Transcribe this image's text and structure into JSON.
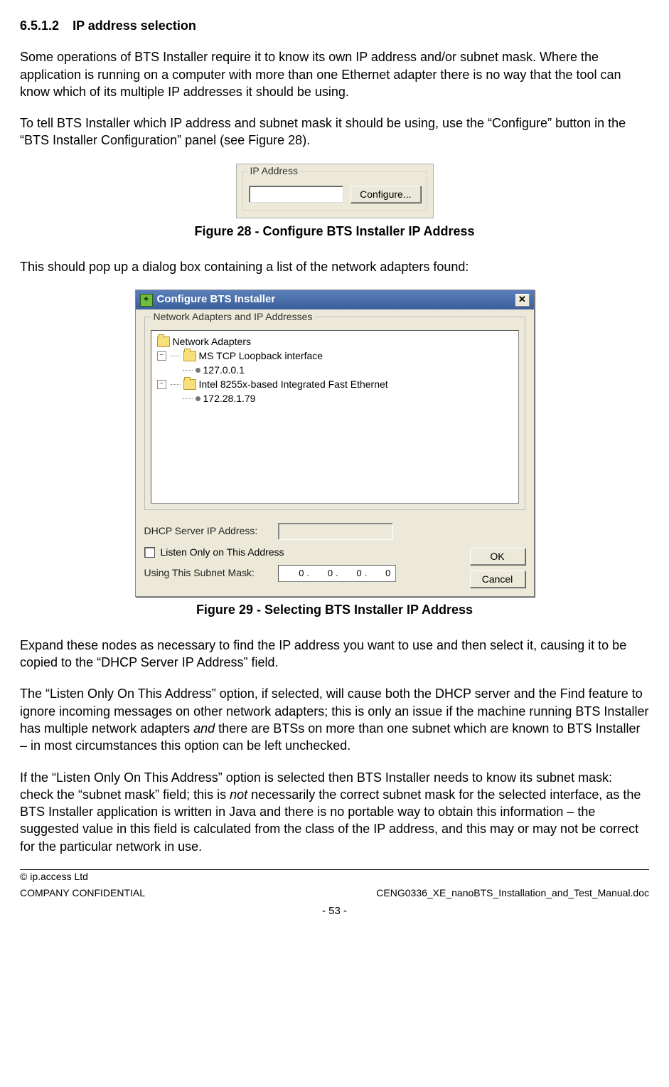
{
  "section": {
    "number": "6.5.1.2",
    "title": "IP address selection"
  },
  "para1": "Some operations of BTS Installer require it to know its own IP address and/or subnet mask. Where the application is running on a computer with more than one Ethernet adapter there is no way that the tool can know which of its multiple IP addresses it should be using.",
  "para2": "To tell BTS Installer which IP address and subnet mask it should be using, use the “Configure” button in the “BTS Installer Configuration” panel (see Figure 28).",
  "fig28": {
    "group_label": "IP Address",
    "configure_btn": "Configure...",
    "caption": "Figure 28 - Configure BTS Installer IP Address"
  },
  "para3": "This should pop up a dialog box containing a list of the network adapters found:",
  "fig29": {
    "title": "Configure BTS Installer",
    "group_label": "Network Adapters and IP Addresses",
    "tree": {
      "root": "Network Adapters",
      "adapter1": "MS TCP Loopback interface",
      "ip1": "127.0.0.1",
      "adapter2": "Intel 8255x-based Integrated Fast Ethernet",
      "ip2": "172.28.1.79"
    },
    "dhcp_label": "DHCP Server IP Address:",
    "listen_label": "Listen Only on This Address",
    "subnet_label": "Using This Subnet Mask:",
    "subnet": {
      "a": "0",
      "b": "0",
      "c": "0",
      "d": "0"
    },
    "ok": "OK",
    "cancel": "Cancel",
    "caption": "Figure 29 - Selecting BTS Installer IP Address"
  },
  "para4": "Expand these nodes as necessary to find the IP address you want to use and then select it, causing it to be copied to the “DHCP Server IP Address” field.",
  "para5a": "The “Listen Only On This Address” option, if selected, will cause both the DHCP server  and the Find feature to ignore incoming messages on other network adapters; this is only an issue if the machine running BTS Installer has multiple network adapters ",
  "para5_italic": "and",
  "para5b": " there are BTSs on more than one subnet which are known to BTS Installer – in most circumstances this option can be left unchecked.",
  "para6a": "If the “Listen Only On This Address” option is selected then BTS Installer needs to know its subnet mask: check the “subnet mask” field; this is ",
  "para6_italic": "not",
  "para6b": " necessarily the correct subnet mask for the selected interface, as the BTS Installer application is written in Java and there is no portable way to obtain this information – the suggested value in this field is calculated from the class of the IP address, and this may or may not be correct for the particular network in use.",
  "footer": {
    "copyright": "© ip.access Ltd",
    "confidential": "COMPANY CONFIDENTIAL",
    "docname": "CENG0336_XE_nanoBTS_Installation_and_Test_Manual.doc",
    "page": "- 53 -"
  }
}
